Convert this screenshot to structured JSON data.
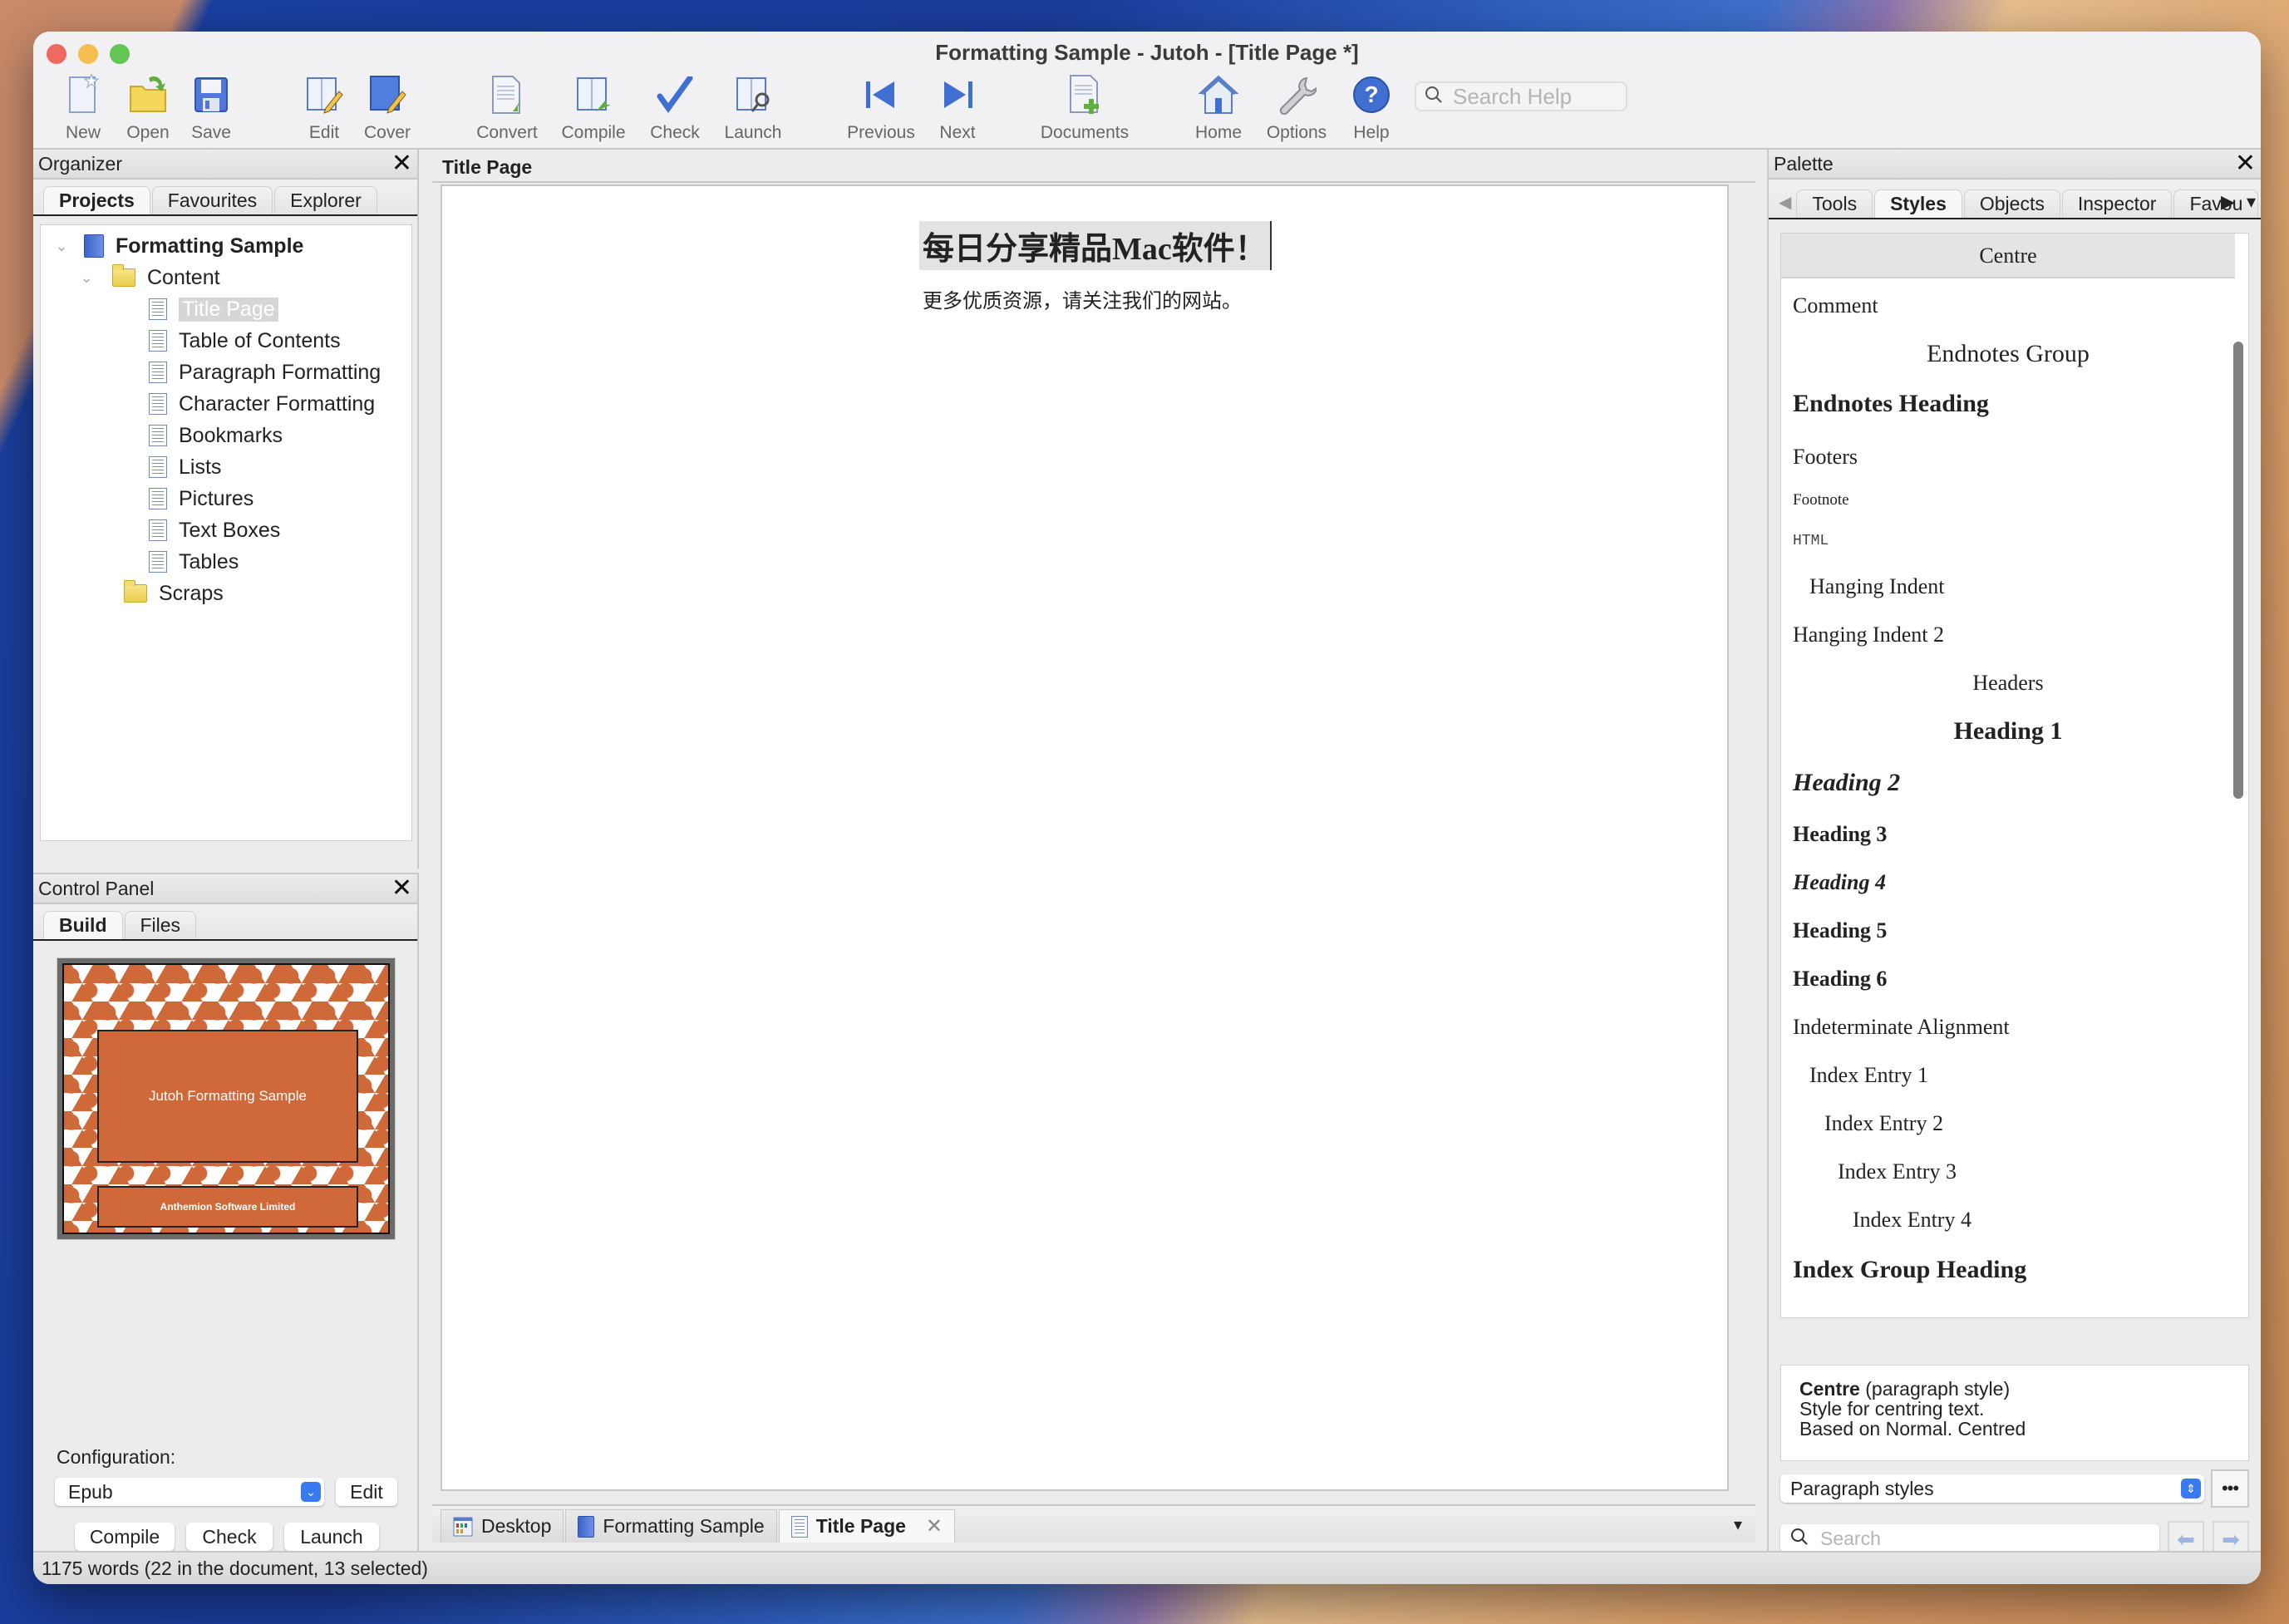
{
  "window": {
    "title": "Formatting Sample - Jutoh - [Title Page *]"
  },
  "toolbar": {
    "buttons": [
      {
        "id": "new",
        "label": "New",
        "icon": "new-document-icon"
      },
      {
        "id": "open",
        "label": "Open",
        "icon": "open-folder-icon"
      },
      {
        "id": "save",
        "label": "Save",
        "icon": "floppy-disk-icon"
      },
      {
        "id": "edit",
        "label": "Edit",
        "icon": "edit-book-icon"
      },
      {
        "id": "cover",
        "label": "Cover",
        "icon": "cover-book-icon"
      },
      {
        "id": "convert",
        "label": "Convert",
        "icon": "convert-document-icon"
      },
      {
        "id": "compile",
        "label": "Compile",
        "icon": "compile-book-icon"
      },
      {
        "id": "check",
        "label": "Check",
        "icon": "checkmark-icon"
      },
      {
        "id": "launch",
        "label": "Launch",
        "icon": "launch-magnifier-icon"
      },
      {
        "id": "previous",
        "label": "Previous",
        "icon": "previous-icon"
      },
      {
        "id": "next",
        "label": "Next",
        "icon": "next-icon"
      },
      {
        "id": "documents",
        "label": "Documents",
        "icon": "add-document-icon"
      },
      {
        "id": "home",
        "label": "Home",
        "icon": "home-icon"
      },
      {
        "id": "options",
        "label": "Options",
        "icon": "wrench-icon"
      },
      {
        "id": "help",
        "label": "Help",
        "icon": "help-icon"
      }
    ],
    "search_placeholder": "Search Help"
  },
  "organizer": {
    "title": "Organizer",
    "tabs": [
      {
        "label": "Projects",
        "active": true
      },
      {
        "label": "Favourites",
        "active": false
      },
      {
        "label": "Explorer",
        "active": false
      }
    ],
    "tree": [
      {
        "label": "Formatting Sample",
        "type": "project",
        "level": 0,
        "expanded": true
      },
      {
        "label": "Content",
        "type": "folder",
        "level": 1,
        "expanded": true
      },
      {
        "label": "Title Page",
        "type": "document",
        "level": 2,
        "selected": true
      },
      {
        "label": "Table of Contents",
        "type": "document",
        "level": 2
      },
      {
        "label": "Paragraph Formatting",
        "type": "document",
        "level": 2
      },
      {
        "label": "Character Formatting",
        "type": "document",
        "level": 2
      },
      {
        "label": "Bookmarks",
        "type": "document",
        "level": 2
      },
      {
        "label": "Lists",
        "type": "document",
        "level": 2
      },
      {
        "label": "Pictures",
        "type": "document",
        "level": 2
      },
      {
        "label": "Text Boxes",
        "type": "document",
        "level": 2
      },
      {
        "label": "Tables",
        "type": "document",
        "level": 2
      },
      {
        "label": "Scraps",
        "type": "folder",
        "level": 1
      }
    ]
  },
  "control_panel": {
    "title": "Control Panel",
    "tabs": [
      {
        "label": "Build",
        "active": true
      },
      {
        "label": "Files",
        "active": false
      }
    ],
    "cover": {
      "title": "Jutoh Formatting Sample",
      "publisher": "Anthemion Software Limited"
    },
    "configuration_label": "Configuration:",
    "configuration_value": "Epub",
    "edit_label": "Edit",
    "compile_label": "Compile",
    "check_label": "Check",
    "launch_label": "Launch"
  },
  "editor": {
    "header": "Title Page",
    "document": {
      "title": "每日分享精品Mac软件！",
      "subtitle": "更多优质资源，请关注我们的网站。"
    },
    "tabs": [
      {
        "label": "Desktop",
        "icon": "desktop-icon",
        "active": false
      },
      {
        "label": "Formatting Sample",
        "icon": "book-icon",
        "active": false
      },
      {
        "label": "Title Page",
        "icon": "document-icon",
        "active": true,
        "closable": true
      }
    ]
  },
  "palette": {
    "title": "Palette",
    "tabs": [
      {
        "label": "Tools",
        "active": false
      },
      {
        "label": "Styles",
        "active": true
      },
      {
        "label": "Objects",
        "active": false
      },
      {
        "label": "Inspector",
        "active": false
      },
      {
        "label": "Favou",
        "active": false
      }
    ],
    "styles": [
      {
        "name": "Centre",
        "selected": true
      },
      {
        "name": "Comment"
      },
      {
        "name": "Endnotes Group"
      },
      {
        "name": "Endnotes Heading"
      },
      {
        "name": "Footers"
      },
      {
        "name": "Footnote"
      },
      {
        "name": "HTML"
      },
      {
        "name": "Hanging Indent"
      },
      {
        "name": "Hanging Indent 2"
      },
      {
        "name": "Headers"
      },
      {
        "name": "Heading 1"
      },
      {
        "name": "Heading 2"
      },
      {
        "name": "Heading 3"
      },
      {
        "name": "Heading 4"
      },
      {
        "name": "Heading 5"
      },
      {
        "name": "Heading 6"
      },
      {
        "name": "Indeterminate Alignment"
      },
      {
        "name": "Index Entry 1"
      },
      {
        "name": "Index Entry 2"
      },
      {
        "name": "Index Entry 3"
      },
      {
        "name": "Index Entry 4"
      },
      {
        "name": "Index Group Heading"
      }
    ],
    "description": {
      "name": "Centre",
      "kind": "(paragraph style)",
      "line2": "Style for centring text.",
      "line3": "Based on Normal. Centred"
    },
    "style_type": "Paragraph styles",
    "more_label": "•••",
    "search_placeholder": "Search"
  },
  "status_bar": {
    "text": "1175 words (22 in the document, 13 selected)"
  }
}
